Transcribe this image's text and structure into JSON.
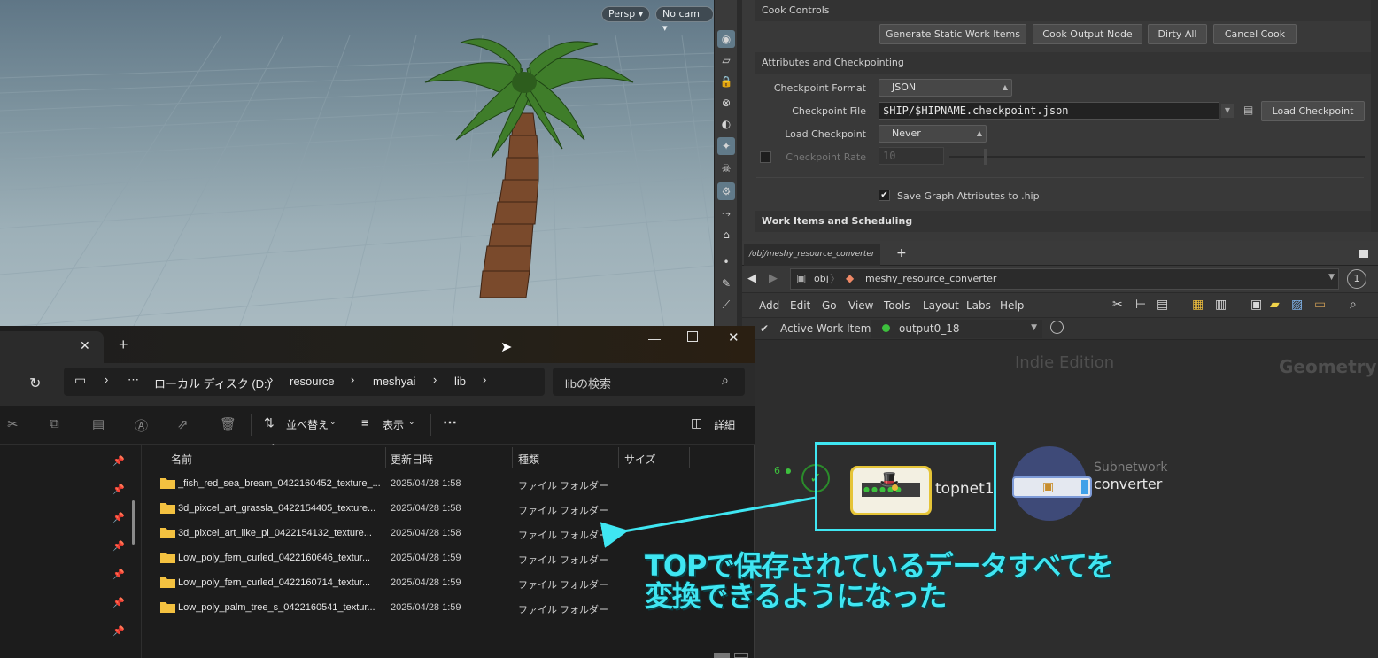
{
  "viewport": {
    "persp_label": "Persp",
    "cam_label": "No cam"
  },
  "params": {
    "cook_controls_title": "Cook Controls",
    "buttons": {
      "generate": "Generate Static Work Items",
      "cook_output": "Cook Output Node",
      "dirty_all": "Dirty All",
      "cancel_cook": "Cancel Cook"
    },
    "attributes_title": "Attributes and Checkpointing",
    "checkpoint_format_label": "Checkpoint Format",
    "checkpoint_format_value": "JSON",
    "checkpoint_file_label": "Checkpoint File",
    "checkpoint_file_value": "$HIP/$HIPNAME.checkpoint.json",
    "load_checkpoint_button": "Load Checkpoint",
    "load_checkpoint_label": "Load Checkpoint",
    "load_checkpoint_value": "Never",
    "checkpoint_rate_label": "Checkpoint Rate",
    "checkpoint_rate_value": "10",
    "save_graph_label": "Save Graph Attributes to .hip",
    "work_items_title": "Work Items and Scheduling"
  },
  "network": {
    "tab_path": "/obj/meshy_resource_converter",
    "add_tab": "+",
    "path_root": "obj",
    "path_node": "meshy_resource_converter",
    "path_badge": "1",
    "menu": [
      "Add",
      "Edit",
      "Go",
      "View",
      "Tools",
      "Layout",
      "Labs",
      "Help"
    ],
    "active_work_item_label": "Active Work Item:",
    "active_work_item_value": "output0_18",
    "watermark_edition": "Indie Edition",
    "watermark_context": "Geometry",
    "node_count": "6",
    "node_topnet_name": "topnet1",
    "node_subnet_type": "Subnetwork",
    "node_subnet_name": "converter"
  },
  "explorer": {
    "add_tab": "+",
    "breadcrumb": [
      "ローカル ディスク (D:)",
      "resource",
      "meshyai",
      "lib"
    ],
    "search_placeholder": "libの検索",
    "sort_label": "並べ替え",
    "view_label": "表示",
    "details_label": "詳細",
    "columns": {
      "name": "名前",
      "date": "更新日時",
      "type": "種類",
      "size": "サイズ"
    },
    "rows": [
      {
        "name": "_fish_red_sea_bream_0422160452_texture_...",
        "date": "2025/04/28 1:58",
        "type": "ファイル フォルダー"
      },
      {
        "name": "3d_pixcel_art_grassla_0422154405_texture...",
        "date": "2025/04/28 1:58",
        "type": "ファイル フォルダー"
      },
      {
        "name": "3d_pixcel_art_like_pl_0422154132_texture...",
        "date": "2025/04/28 1:58",
        "type": "ファイル フォルダー"
      },
      {
        "name": "Low_poly_fern_curled_0422160646_textur...",
        "date": "2025/04/28 1:59",
        "type": "ファイル フォルダー"
      },
      {
        "name": "Low_poly_fern_curled_0422160714_textur...",
        "date": "2025/04/28 1:59",
        "type": "ファイル フォルダー"
      },
      {
        "name": "Low_poly_palm_tree_s_0422160541_textur...",
        "date": "2025/04/28 1:59",
        "type": "ファイル フォルダー"
      }
    ]
  },
  "annotation": {
    "line1": "TOPで保存されているデータすべてを",
    "line2": "変換できるようになった",
    "color": "#3fe6f2"
  }
}
